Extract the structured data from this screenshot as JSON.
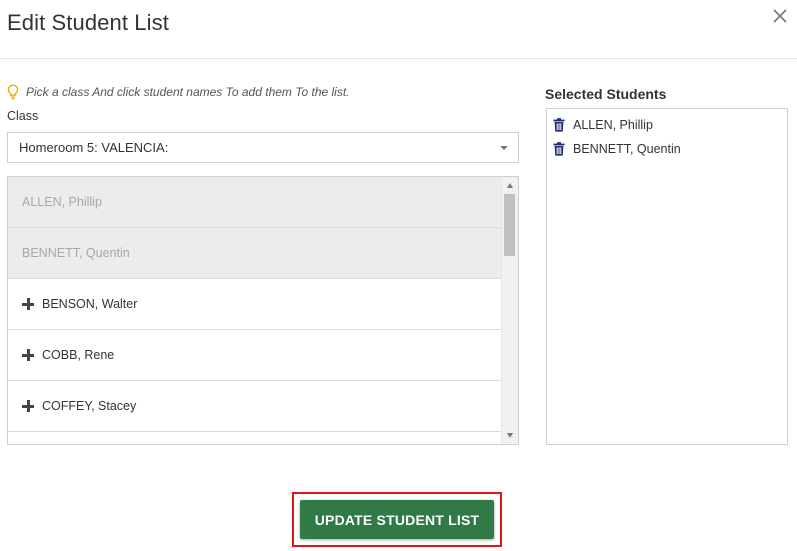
{
  "modal": {
    "title": "Edit Student List",
    "close_icon": "close-icon"
  },
  "hint": {
    "icon": "lightbulb-icon",
    "icon_color": "#f0ad00",
    "text": "Pick a class And click student names To add them To the list."
  },
  "class_field": {
    "label": "Class",
    "selected": "Homeroom 5: VALENCIA:"
  },
  "student_list": {
    "rows": [
      {
        "name": "ALLEN, Phillip",
        "state": "added"
      },
      {
        "name": "BENNETT, Quentin",
        "state": "added"
      },
      {
        "name": "BENSON, Walter",
        "state": "available",
        "icon": "plus-icon"
      },
      {
        "name": "COBB, Rene",
        "state": "available",
        "icon": "plus-icon"
      },
      {
        "name": "COFFEY, Stacey",
        "state": "available",
        "icon": "plus-icon"
      }
    ]
  },
  "selected_students": {
    "title": "Selected Students",
    "icon": "trash-icon",
    "icon_color": "#1f2a6e",
    "items": [
      {
        "name": "ALLEN, Phillip"
      },
      {
        "name": "BENNETT, Quentin"
      }
    ]
  },
  "actions": {
    "update_label": "UPDATE STUDENT LIST",
    "update_color": "#2f7a47",
    "highlight_color": "#e0141e"
  }
}
